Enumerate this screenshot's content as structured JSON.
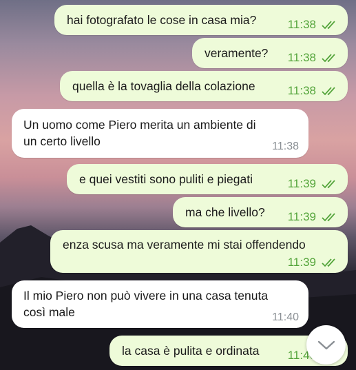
{
  "messages": [
    {
      "id": "m1",
      "direction": "out",
      "text": "hai fotografato le cose in casa mia?",
      "time": "11:38",
      "status": "read"
    },
    {
      "id": "m2",
      "direction": "out",
      "text": "veramente?",
      "time": "11:38",
      "status": "read"
    },
    {
      "id": "m3",
      "direction": "out",
      "text": "quella è la tovaglia della colazione",
      "time": "11:38",
      "status": "read"
    },
    {
      "id": "m4",
      "direction": "in",
      "text_line1": "Un uomo come Piero merita un ambiente di",
      "text_line2": "un certo livello",
      "time": "11:38"
    },
    {
      "id": "m5",
      "direction": "out",
      "text": "e quei vestiti sono puliti e piegati",
      "time": "11:39",
      "status": "read"
    },
    {
      "id": "m6",
      "direction": "out",
      "text": "ma che livello?",
      "time": "11:39",
      "status": "read"
    },
    {
      "id": "m7",
      "direction": "out",
      "text": "enza scusa ma veramente mi stai offendendo",
      "time": "11:39",
      "status": "read"
    },
    {
      "id": "m8",
      "direction": "in",
      "text_line1": "Il mio Piero non può vivere in una casa tenuta",
      "text_line2": "così male",
      "time": "11:40"
    },
    {
      "id": "m9",
      "direction": "out",
      "text": "la casa è pulita e ordinata",
      "time": "11:40",
      "status": "read"
    }
  ],
  "icons": {
    "read_receipt": "double-check-icon",
    "scroll_down": "chevron-down-icon"
  },
  "colors": {
    "outgoing_bubble": "#eefbd9",
    "incoming_bubble": "#ffffff",
    "outgoing_time": "#53a43a",
    "incoming_time": "#8a8f94"
  }
}
